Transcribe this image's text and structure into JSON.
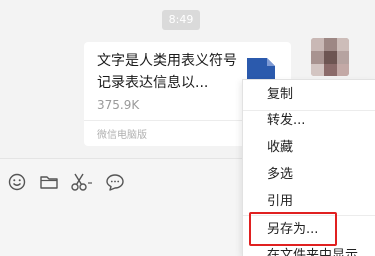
{
  "chat": {
    "time": "8:49",
    "file": {
      "name": "文字是人类用表义符号记录表达信息以...",
      "size": "375.9K",
      "source": "微信电脑版"
    }
  },
  "toolbar": {
    "icons": [
      "emoji-icon",
      "folder-icon",
      "scissors-icon",
      "chat-bubble-icon"
    ]
  },
  "context_menu": {
    "items": [
      "复制",
      "转发...",
      "收藏",
      "多选",
      "引用",
      "另存为...",
      "在文件夹中显示"
    ],
    "highlighted": "另存为..."
  },
  "colors": {
    "highlight_border": "#e02020",
    "file_icon": "#2b5aad"
  }
}
